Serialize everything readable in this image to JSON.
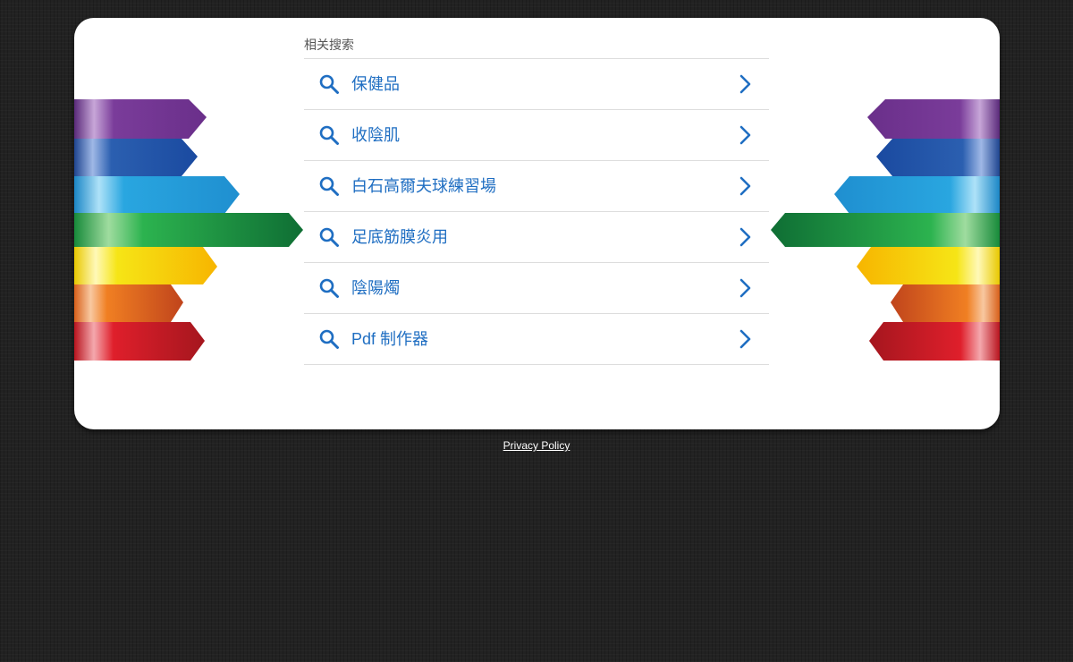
{
  "related": {
    "title": "相关搜索",
    "items": [
      {
        "label": "保健品",
        "icon": "search-icon",
        "arrow": "chevron-right-icon"
      },
      {
        "label": "收陰肌",
        "icon": "search-icon",
        "arrow": "chevron-right-icon"
      },
      {
        "label": "白石高爾夫球練習場",
        "icon": "search-icon",
        "arrow": "chevron-right-icon"
      },
      {
        "label": "足底筋膜炎用",
        "icon": "search-icon",
        "arrow": "chevron-right-icon"
      },
      {
        "label": "陰陽燭",
        "icon": "search-icon",
        "arrow": "chevron-right-icon"
      },
      {
        "label": "Pdf 制作器",
        "icon": "search-icon",
        "arrow": "chevron-right-icon"
      }
    ]
  },
  "footer": {
    "privacy_label": "Privacy Policy"
  },
  "colors": {
    "link": "#1f6ec2",
    "page_bg": "#222222",
    "card_bg": "#ffffff",
    "ribbon_purple": "#7a3c9a",
    "ribbon_blue": "#2b5fb0",
    "ribbon_cyan": "#29a6e0",
    "ribbon_green": "#24a04a",
    "ribbon_yellow": "#f6d816",
    "ribbon_orange": "#f07f22",
    "ribbon_red": "#df1f2b"
  }
}
